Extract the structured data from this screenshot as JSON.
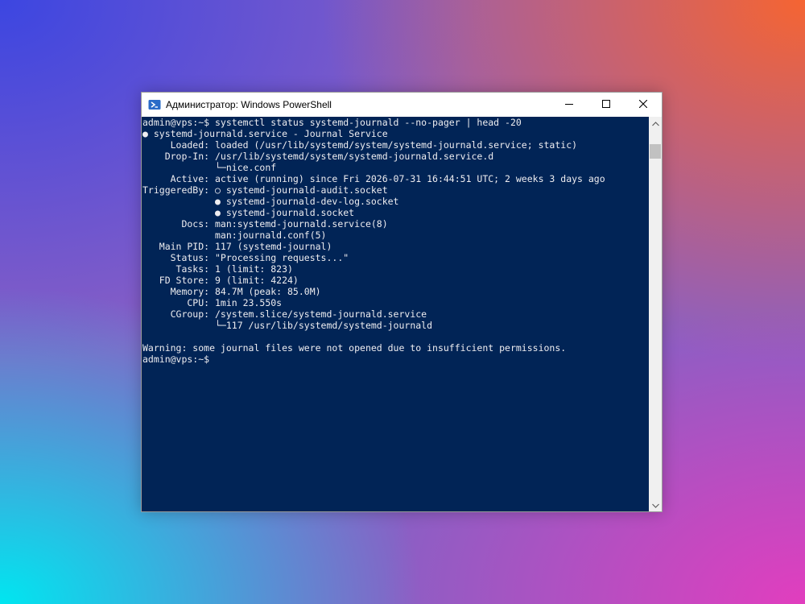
{
  "window": {
    "title": "Администратор: Windows PowerShell",
    "icon": "powershell-icon",
    "controls": [
      "minimize-icon",
      "maximize-icon",
      "close-icon"
    ]
  },
  "console": {
    "background": "#012456",
    "foreground": "#eeedf0",
    "lines": [
      "admin@vps:~$ systemctl status systemd-journald --no-pager | head -20",
      "● systemd-journald.service - Journal Service",
      "     Loaded: loaded (/usr/lib/systemd/system/systemd-journald.service; static)",
      "    Drop-In: /usr/lib/systemd/system/systemd-journald.service.d",
      "             └─nice.conf",
      "     Active: active (running) since Fri 2026-07-31 16:44:51 UTC; 2 weeks 3 days ago",
      "TriggeredBy: ○ systemd-journald-audit.socket",
      "             ● systemd-journald-dev-log.socket",
      "             ● systemd-journald.socket",
      "       Docs: man:systemd-journald.service(8)",
      "             man:journald.conf(5)",
      "   Main PID: 117 (systemd-journal)",
      "     Status: \"Processing requests...\"",
      "      Tasks: 1 (limit: 823)",
      "   FD Store: 9 (limit: 4224)",
      "     Memory: 84.7M (peak: 85.0M)",
      "        CPU: 1min 23.550s",
      "     CGroup: /system.slice/systemd-journald.service",
      "             └─117 /usr/lib/systemd/systemd-journald",
      "",
      "Warning: some journal files were not opened due to insufficient permissions.",
      "admin@vps:~$"
    ]
  }
}
